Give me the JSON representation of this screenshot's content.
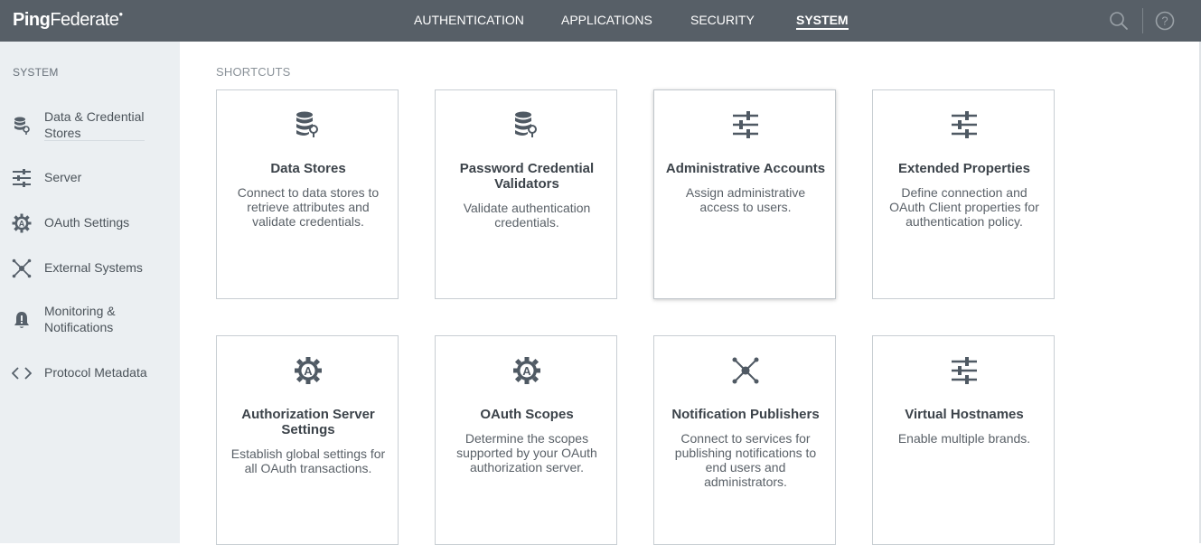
{
  "app": {
    "logo_ping": "Ping",
    "logo_federate": "Federate"
  },
  "nav": {
    "items": [
      {
        "label": "AUTHENTICATION",
        "active": false
      },
      {
        "label": "APPLICATIONS",
        "active": false
      },
      {
        "label": "SECURITY",
        "active": false
      },
      {
        "label": "SYSTEM",
        "active": true
      }
    ],
    "search_icon": "search-icon",
    "help_icon": "help-icon"
  },
  "sidebar": {
    "heading": "SYSTEM",
    "items": [
      {
        "label": "Data & Credential Stores",
        "icon": "database-key-icon",
        "selected": true
      },
      {
        "label": "Server",
        "icon": "sliders-icon"
      },
      {
        "label": "OAuth Settings",
        "icon": "gear-a-icon"
      },
      {
        "label": "External Systems",
        "icon": "network-nodes-icon"
      },
      {
        "label": "Monitoring & Notifications",
        "icon": "bell-icon"
      },
      {
        "label": "Protocol Metadata",
        "icon": "code-brackets-icon"
      }
    ]
  },
  "main": {
    "section_title": "SHORTCUTS",
    "cards": [
      {
        "title": "Data Stores",
        "description": "Connect to data stores to retrieve attributes and validate credentials.",
        "icon": "database-key-icon"
      },
      {
        "title": "Password Credential Validators",
        "description": "Validate authentication credentials.",
        "icon": "database-key-icon"
      },
      {
        "title": "Administrative Accounts",
        "description": "Assign administrative access to users.",
        "icon": "sliders-icon"
      },
      {
        "title": "Extended Properties",
        "description": "Define connection and OAuth Client properties for authentication policy.",
        "icon": "sliders-icon"
      },
      {
        "title": "Authorization Server Settings",
        "description": "Establish global settings for all OAuth transactions.",
        "icon": "gear-a-icon"
      },
      {
        "title": "OAuth Scopes",
        "description": "Determine the scopes supported by your OAuth authorization server.",
        "icon": "gear-a-icon"
      },
      {
        "title": "Notification Publishers",
        "description": "Connect to services for publishing notifications to end users and administrators.",
        "icon": "network-nodes-icon"
      },
      {
        "title": "Virtual Hostnames",
        "description": "Enable multiple brands.",
        "icon": "sliders-icon"
      }
    ]
  },
  "colors": {
    "topbar": "#575f67",
    "sidebar": "#ebeff2",
    "icon": "#4f5963",
    "text": "#3c434a"
  }
}
